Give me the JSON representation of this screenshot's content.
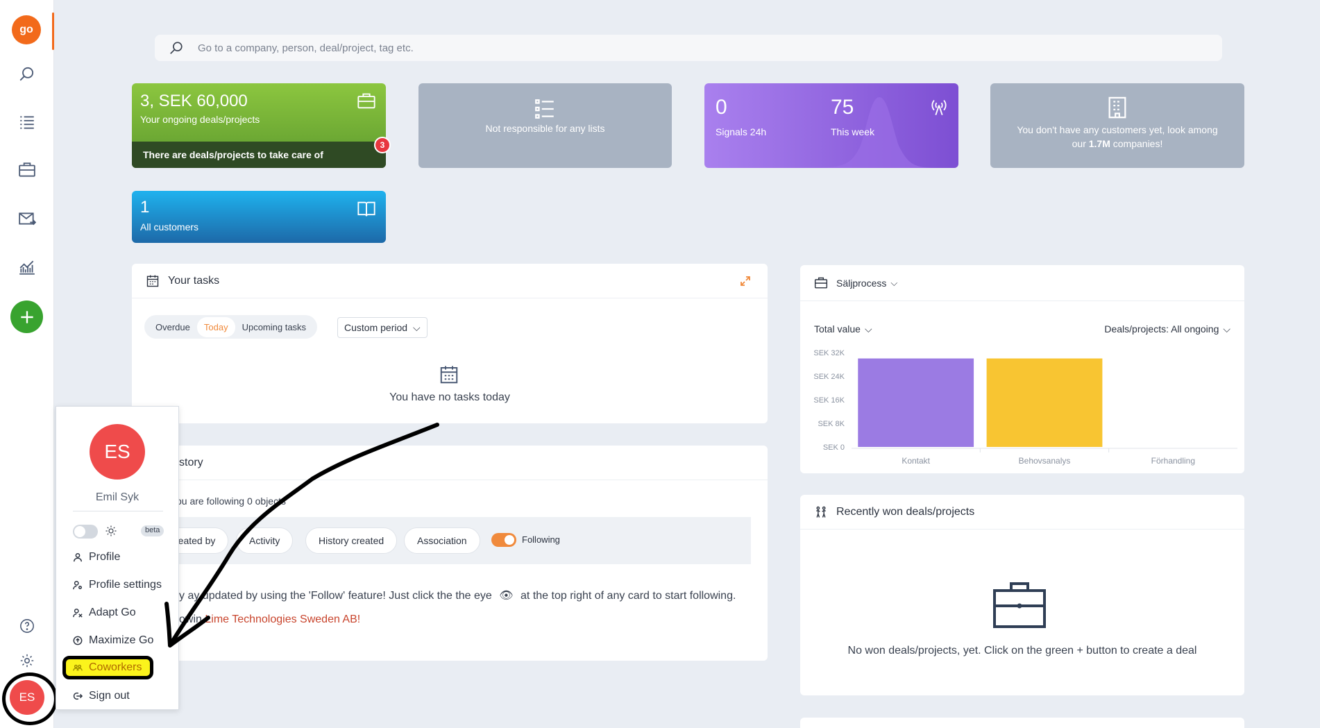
{
  "app": {
    "logo_text": "go",
    "accent_color": "#f26a1b"
  },
  "sidebar": {
    "items": [
      {
        "name": "search-icon"
      },
      {
        "name": "list-icon"
      },
      {
        "name": "briefcase-icon"
      },
      {
        "name": "mail-icon"
      },
      {
        "name": "chart-icon"
      }
    ],
    "add_icon": "plus-icon",
    "help_icon": "help-icon",
    "settings_icon": "gear-icon",
    "avatar_initials": "ES"
  },
  "search": {
    "placeholder": "Go to a company, person, deal/project, tag etc."
  },
  "cards": {
    "deals": {
      "value": "3, SEK 60,000",
      "label": "Your ongoing deals/projects",
      "footer": "There are deals/projects to take care of",
      "badge": "3",
      "color": "#8cc63f"
    },
    "lists": {
      "label": "Not responsible for any lists"
    },
    "signals": {
      "count_24h": "0",
      "label_24h": "Signals 24h",
      "count_week": "75",
      "label_week": "This week",
      "color": "#8b5cf6"
    },
    "customers_hint": {
      "text_before": "You don't have any customers yet, look among our ",
      "highlight": "1.7M",
      "text_after": " companies!"
    },
    "customers": {
      "value": "1",
      "label": "All customers",
      "color": "#1fa0dc"
    }
  },
  "tasks": {
    "title": "Your tasks",
    "tabs": [
      "Overdue",
      "Today",
      "Upcoming tasks"
    ],
    "active_tab": "Today",
    "period_label": "Custom period",
    "empty_text": "You have no tasks today"
  },
  "history": {
    "title": "story",
    "following_text": "ou are following 0 objects",
    "filters": [
      "reated by",
      "Activity",
      "History created",
      "Association"
    ],
    "toggle_label": "Following",
    "info_start": "y  ay updated by using the 'Follow' feature! Just click the the eye",
    "info_end": "at the top right of any card to start following.",
    "follow_prefix": "owin  ",
    "follow_link": "Lime Technologies Sweden AB!"
  },
  "sales": {
    "title": "Säljprocess",
    "metric_label": "Total value",
    "filter_label": "Deals/projects: All ongoing"
  },
  "chart_data": {
    "type": "bar",
    "categories": [
      "Kontakt",
      "Behovsanalys",
      "Förhandling"
    ],
    "values": [
      30000,
      30000,
      0
    ],
    "colors": [
      "#9b7be3",
      "#f8c532",
      "#cccccc"
    ],
    "ytick_labels": [
      "SEK 32K",
      "SEK 24K",
      "SEK 16K",
      "SEK 8K",
      "SEK 0"
    ],
    "ylim": [
      0,
      32000
    ],
    "xlabel": "",
    "ylabel": "",
    "title": ""
  },
  "won": {
    "title": "Recently won deals/projects",
    "empty_text": "No won deals/projects, yet. Click on the green + button to create a deal"
  },
  "user_menu": {
    "initials": "ES",
    "name": "Emil Syk",
    "beta_label": "beta",
    "items": [
      {
        "label": "Profile",
        "icon": "user-icon"
      },
      {
        "label": "Profile settings",
        "icon": "user-settings-icon"
      },
      {
        "label": "Adapt Go",
        "icon": "adapt-icon"
      },
      {
        "label": "Maximize Go",
        "icon": "arrow-up-circle-icon"
      },
      {
        "label": "Coworkers",
        "icon": "coworkers-icon"
      },
      {
        "label": "Sign out",
        "icon": "sign-out-icon"
      }
    ]
  }
}
